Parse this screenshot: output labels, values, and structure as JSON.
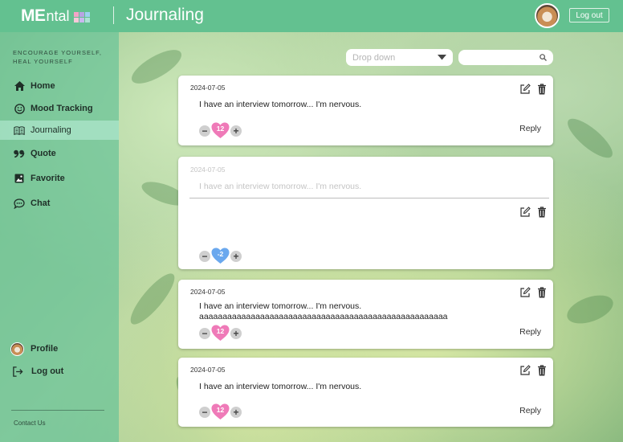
{
  "header": {
    "logo_me": "ME",
    "logo_rest": "ntal",
    "logo_colors": [
      "#f5a3c7",
      "#b8a4e3",
      "#9dd2f0",
      "#f7c9d9",
      "#c9b8ef",
      "#aee3d5"
    ],
    "title": "Journaling",
    "logout_label": "Log out"
  },
  "sidebar": {
    "tagline_1": "ENCOURAGE YOURSELF,",
    "tagline_2": "HEAL YOURSELF",
    "items": [
      {
        "label": "Home",
        "icon": "home-icon"
      },
      {
        "label": "Mood Tracking",
        "icon": "smiley-icon"
      },
      {
        "label": "Journaling",
        "icon": "book-icon",
        "active": true
      },
      {
        "label": "Quote",
        "icon": "quote-icon"
      },
      {
        "label": "Favorite",
        "icon": "image-icon"
      },
      {
        "label": "Chat",
        "icon": "chat-bubble-icon"
      }
    ],
    "profile_label": "Profile",
    "logout_label": "Log out",
    "contact_label": "Contact Us"
  },
  "filters": {
    "dropdown_placeholder": "Drop down",
    "search_value": ""
  },
  "entries": [
    {
      "date": "2024-07-05",
      "text": "I have an interview tomorrow... I'm nervous.",
      "text2": "",
      "score": "12",
      "heart_color": "#ef7ab8",
      "reply_label": "Reply"
    },
    {
      "date": "2024-07-05",
      "text": "I have an interview tomorrow... I'm nervous.",
      "text2": "",
      "score": "-2",
      "heart_color": "#6aa8ee",
      "reply_label": "",
      "editing": true
    },
    {
      "date": "2024-07-05",
      "text": "I have an interview tomorrow... I'm nervous.",
      "text2": "aaaaaaaaaaaaaaaaaaaaaaaaaaaaaaaaaaaaaaaaaaaaaaaaaaaaa",
      "score": "12",
      "heart_color": "#ef7ab8",
      "reply_label": "Reply"
    },
    {
      "date": "2024-07-05",
      "text": "I have an interview tomorrow... I'm nervous.",
      "text2": "",
      "score": "12",
      "heart_color": "#ef7ab8",
      "reply_label": "Reply"
    }
  ],
  "vote_minus": "−",
  "vote_plus": "+",
  "colors": {
    "header_green": "#63c190",
    "sidebar_green": "#69c498",
    "heart_pink": "#ef7ab8",
    "heart_blue": "#6aa8ee"
  }
}
